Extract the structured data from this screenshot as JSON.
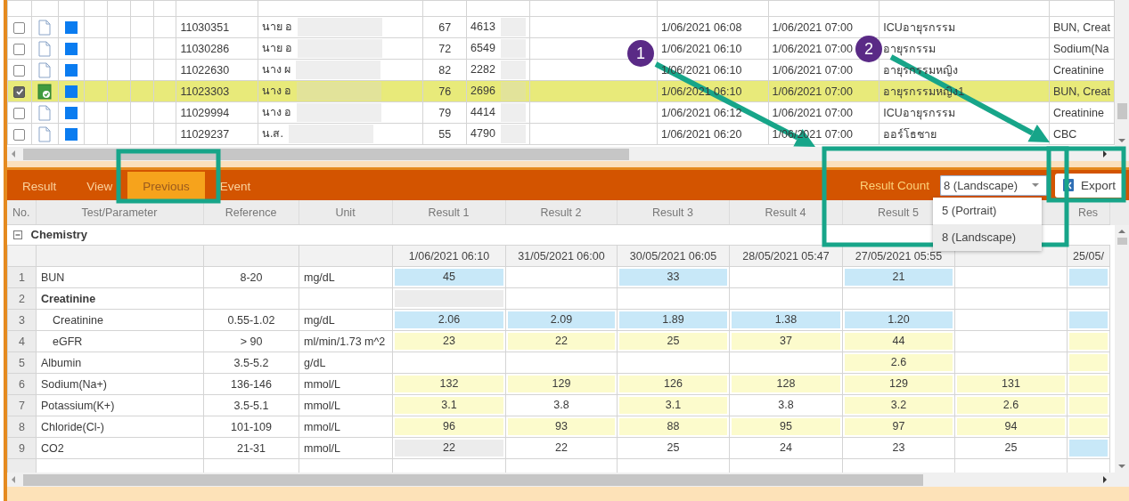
{
  "top_grid": {
    "rows": [
      {
        "checked": false,
        "selected": false,
        "verified": false,
        "patient_id": "11030351",
        "name": "นาย อ",
        "age": "67",
        "number": "4613",
        "collected": "1/06/2021 06:08",
        "due": "1/06/2021 07:00",
        "ward": "ICUอายุรกรรม",
        "tests": "BUN, Creat"
      },
      {
        "checked": false,
        "selected": false,
        "verified": false,
        "patient_id": "11030286",
        "name": "นาย อ",
        "age": "72",
        "number": "6549",
        "collected": "1/06/2021 06:10",
        "due": "1/06/2021 07:00",
        "ward": "อายุรกรรม",
        "tests": "Sodium(Na"
      },
      {
        "checked": false,
        "selected": false,
        "verified": false,
        "patient_id": "11022630",
        "name": "นาง ผ",
        "age": "82",
        "number": "2282",
        "collected": "1/06/2021 06:10",
        "due": "1/06/2021 07:00",
        "ward": "อายุรกรรมหญิง",
        "tests": "Creatinine"
      },
      {
        "checked": true,
        "selected": true,
        "verified": true,
        "patient_id": "11023303",
        "name": "นาง อ",
        "age": "76",
        "number": "2696",
        "collected": "1/06/2021 06:10",
        "due": "1/06/2021 07:00",
        "ward": "อายุรกรรมหญิง1",
        "tests": "BUN, Creat"
      },
      {
        "checked": false,
        "selected": false,
        "verified": false,
        "patient_id": "11029994",
        "name": "นาง อ",
        "age": "79",
        "number": "4414",
        "collected": "1/06/2021 06:12",
        "due": "1/06/2021 07:00",
        "ward": "ICUอายุรกรรม",
        "tests": "Creatinine"
      },
      {
        "checked": false,
        "selected": false,
        "verified": false,
        "patient_id": "11029237",
        "name": "น.ส.",
        "age": "55",
        "number": "4790",
        "collected": "1/06/2021 06:20",
        "due": "1/06/2021 07:00",
        "ward": "ออร์โธชาย",
        "tests": "CBC"
      }
    ]
  },
  "tabs": [
    {
      "label": "Result",
      "selected": false
    },
    {
      "label": "View",
      "selected": false
    },
    {
      "label": "Previous",
      "selected": true
    },
    {
      "label": "Event",
      "selected": false
    }
  ],
  "result_count": {
    "label": "Result Count",
    "value": "8 (Landscape)",
    "expanded": true,
    "options": [
      {
        "label": "5 (Portrait)",
        "selected": false
      },
      {
        "label": "8 (Landscape)",
        "selected": true
      }
    ]
  },
  "export_button": {
    "label": "Export"
  },
  "results_grid": {
    "columns": [
      "No.",
      "Test/Parameter",
      "Reference",
      "Unit",
      "Result 1",
      "Result 2",
      "Result 3",
      "Result 4",
      "Result 5"
    ],
    "last_column": "Res",
    "group": {
      "label": "Chemistry",
      "expanded": true
    },
    "dates": [
      "1/06/2021 06:10",
      "31/05/2021 06:00",
      "30/05/2021 06:05",
      "28/05/2021 05:47",
      "27/05/2021 05:55"
    ],
    "last_date": "25/05/",
    "rows": [
      {
        "no": "1",
        "test": "BUN",
        "kind": "item",
        "reference": "8-20",
        "unit": "mg/dL",
        "results": [
          {
            "value": "45",
            "color": "#c8e8f8"
          },
          {
            "kind": "empty"
          },
          {
            "value": "33",
            "color": "#c8e8f8"
          },
          {
            "kind": "empty"
          },
          {
            "value": "21",
            "color": "#c8e8f8"
          },
          {
            "kind": "empty"
          },
          {
            "color": "#c8e8f8"
          }
        ]
      },
      {
        "no": "2",
        "test": "Creatinine",
        "kind": "group",
        "results": [
          {
            "color": "#ececec"
          },
          {
            "kind": "empty"
          },
          {
            "kind": "empty"
          },
          {
            "kind": "empty"
          },
          {
            "kind": "empty"
          },
          {
            "kind": "empty"
          },
          {
            "kind": "empty"
          }
        ]
      },
      {
        "no": "3",
        "test": "Creatinine",
        "kind": "sub",
        "reference": "0.55-1.02",
        "unit": "mg/dL",
        "results": [
          {
            "value": "2.06",
            "color": "#c8e8f8"
          },
          {
            "value": "2.09",
            "color": "#c8e8f8"
          },
          {
            "value": "1.89",
            "color": "#c8e8f8"
          },
          {
            "value": "1.38",
            "color": "#c8e8f8"
          },
          {
            "value": "1.20",
            "color": "#c8e8f8"
          },
          {
            "kind": "empty"
          },
          {
            "color": "#c8e8f8"
          }
        ]
      },
      {
        "no": "4",
        "test": "eGFR",
        "kind": "sub",
        "reference": "> 90",
        "unit": "ml/min/1.73 m^2",
        "results": [
          {
            "value": "23",
            "color": "#fcfbcc"
          },
          {
            "value": "22",
            "color": "#fcfbcc"
          },
          {
            "value": "25",
            "color": "#fcfbcc"
          },
          {
            "value": "37",
            "color": "#fcfbcc"
          },
          {
            "value": "44",
            "color": "#fcfbcc"
          },
          {
            "kind": "empty"
          },
          {
            "color": "#fcfbcc"
          }
        ]
      },
      {
        "no": "5",
        "test": "Albumin",
        "kind": "item",
        "reference": "3.5-5.2",
        "unit": "g/dL",
        "results": [
          {
            "kind": "empty"
          },
          {
            "kind": "empty"
          },
          {
            "kind": "empty"
          },
          {
            "kind": "empty"
          },
          {
            "value": "2.6",
            "color": "#fcfbcc"
          },
          {
            "kind": "empty"
          },
          {
            "color": "#fcfbcc"
          }
        ]
      },
      {
        "no": "6",
        "test": "Sodium(Na+)",
        "kind": "item",
        "reference": "136-146",
        "unit": "mmol/L",
        "results": [
          {
            "value": "132",
            "color": "#fcfbcc"
          },
          {
            "value": "129",
            "color": "#fcfbcc"
          },
          {
            "value": "126",
            "color": "#fcfbcc"
          },
          {
            "value": "128",
            "color": "#fcfbcc"
          },
          {
            "value": "129",
            "color": "#fcfbcc"
          },
          {
            "value": "131",
            "color": "#fcfbcc"
          },
          {
            "color": "#fcfbcc"
          }
        ]
      },
      {
        "no": "7",
        "test": "Potassium(K+)",
        "kind": "item",
        "reference": "3.5-5.1",
        "unit": "mmol/L",
        "results": [
          {
            "value": "3.1",
            "color": "#fcfbcc"
          },
          {
            "value": "3.8",
            "color": "#ffffff"
          },
          {
            "value": "3.1",
            "color": "#fcfbcc"
          },
          {
            "value": "3.8",
            "color": "#ffffff"
          },
          {
            "value": "3.2",
            "color": "#fcfbcc"
          },
          {
            "value": "2.6",
            "color": "#fcfbcc"
          },
          {
            "color": "#fcfbcc"
          }
        ]
      },
      {
        "no": "8",
        "test": "Chloride(Cl-)",
        "kind": "item",
        "reference": "101-109",
        "unit": "mmol/L",
        "results": [
          {
            "value": "96",
            "color": "#fcfbcc"
          },
          {
            "value": "93",
            "color": "#fcfbcc"
          },
          {
            "value": "88",
            "color": "#fcfbcc"
          },
          {
            "value": "95",
            "color": "#fcfbcc"
          },
          {
            "value": "97",
            "color": "#fcfbcc"
          },
          {
            "value": "94",
            "color": "#fcfbcc"
          },
          {
            "color": "#fcfbcc"
          }
        ]
      },
      {
        "no": "9",
        "test": "CO2",
        "kind": "item",
        "reference": "21-31",
        "unit": "mmol/L",
        "results": [
          {
            "value": "22",
            "color": "#ececec"
          },
          {
            "value": "22",
            "color": "#ffffff"
          },
          {
            "value": "25",
            "color": "#ffffff"
          },
          {
            "value": "24",
            "color": "#ffffff"
          },
          {
            "value": "23",
            "color": "#ffffff"
          },
          {
            "value": "25",
            "color": "#ffffff"
          },
          {
            "color": "#c8e8f8"
          }
        ]
      }
    ]
  },
  "annotations": {
    "markers": [
      {
        "label": "1"
      },
      {
        "label": "2"
      }
    ]
  }
}
